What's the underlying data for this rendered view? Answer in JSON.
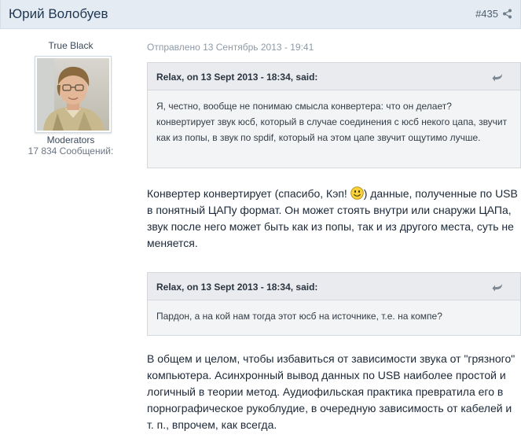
{
  "header": {
    "author": "Юрий Волобуев",
    "post_number": "#435",
    "share_icon": "share-icon"
  },
  "author_info": {
    "title": "True Black",
    "group": "Moderators",
    "post_count": "17 834 Сообщений:"
  },
  "post": {
    "posted_date": "Отправлено 13 Сентябрь 2013 - 19:41",
    "quotes": [
      {
        "citation": "Relax, on 13 Sept 2013 - 18:34, said:",
        "text": "Я, честно, вообще не понимаю смысла конвертера: что он делает? конвертирует звук юсб, который в случае соединения с юсб некого цапа, звучит как из попы, в звук по spdif, который на этом цапе звучит ощутимо лучше."
      },
      {
        "citation": "Relax, on 13 Sept 2013 - 18:34, said:",
        "text": "Пардон, а на кой нам тогда этот юсб на источнике, т.е. на компе?"
      }
    ],
    "reply1_before": "Конвертер конвертирует (спасибо, Кэп! ",
    "reply1_after": ") данные, полученные по USB в понятный ЦАПу формат. Он может стоять внутри или снаружи ЦАПа, звук после него может быть как из попы, так и из другого места, суть не меняется.",
    "reply2": "В общем и целом, чтобы избавиться от зависимости звука от \"грязного\" компьютера. Асинхронный вывод данных по USB наиболее простой и логичный в теории метод. Аудиофильская практика превратила его в порнографическое рукоблудие, в очередную зависимость от кабелей и т. п., впрочем, как всегда."
  },
  "colors": {
    "header_bg": "#e4ebf2",
    "author_link": "#1d3652",
    "quote_bg": "#f3f4f6"
  }
}
